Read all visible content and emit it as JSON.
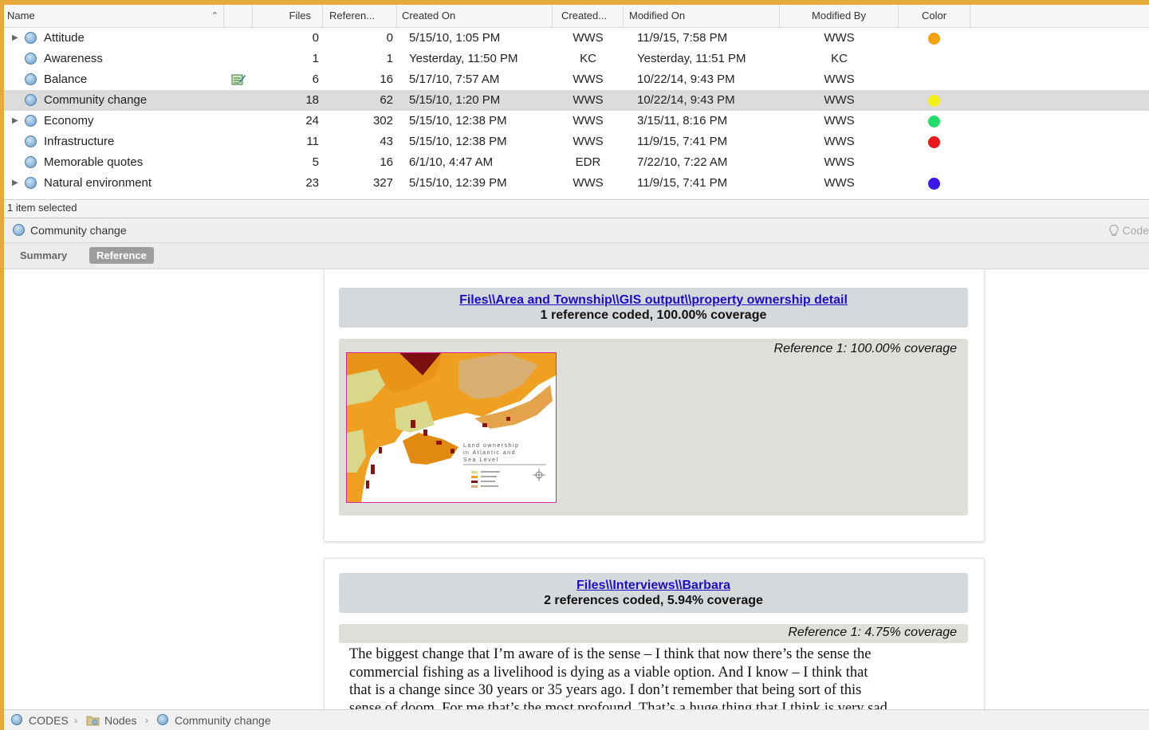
{
  "columns": {
    "name": "Name",
    "files": "Files",
    "references": "Referen...",
    "created_on": "Created On",
    "created_by": "Created...",
    "modified_on": "Modified On",
    "modified_by": "Modified By",
    "color": "Color"
  },
  "nodes": [
    {
      "name": "Attitude",
      "files": "0",
      "refs": "0",
      "created_on": "5/15/10, 1:05 PM",
      "created_by": "WWS",
      "modified_on": "11/9/15, 7:58 PM",
      "modified_by": "WWS",
      "color": "#f5a00f",
      "expandable": true,
      "memo": false,
      "selected": false
    },
    {
      "name": "Awareness",
      "files": "1",
      "refs": "1",
      "created_on": "Yesterday, 11:50 PM",
      "created_by": "KC",
      "modified_on": "Yesterday, 11:51 PM",
      "modified_by": "KC",
      "color": "",
      "expandable": false,
      "memo": false,
      "selected": false
    },
    {
      "name": "Balance",
      "files": "6",
      "refs": "16",
      "created_on": "5/17/10, 7:57 AM",
      "created_by": "WWS",
      "modified_on": "10/22/14, 9:43 PM",
      "modified_by": "WWS",
      "color": "",
      "expandable": false,
      "memo": true,
      "selected": false
    },
    {
      "name": "Community change",
      "files": "18",
      "refs": "62",
      "created_on": "5/15/10, 1:20 PM",
      "created_by": "WWS",
      "modified_on": "10/22/14, 9:43 PM",
      "modified_by": "WWS",
      "color": "#f5ee18",
      "expandable": false,
      "memo": false,
      "selected": true
    },
    {
      "name": "Economy",
      "files": "24",
      "refs": "302",
      "created_on": "5/15/10, 12:38 PM",
      "created_by": "WWS",
      "modified_on": "3/15/11, 8:16 PM",
      "modified_by": "WWS",
      "color": "#22dd6a",
      "expandable": true,
      "memo": false,
      "selected": false
    },
    {
      "name": "Infrastructure",
      "files": "11",
      "refs": "43",
      "created_on": "5/15/10, 12:38 PM",
      "created_by": "WWS",
      "modified_on": "11/9/15, 7:41 PM",
      "modified_by": "WWS",
      "color": "#e81818",
      "expandable": false,
      "memo": false,
      "selected": false
    },
    {
      "name": "Memorable quotes",
      "files": "5",
      "refs": "16",
      "created_on": "6/1/10, 4:47 AM",
      "created_by": "EDR",
      "modified_on": "7/22/10, 7:22 AM",
      "modified_by": "WWS",
      "color": "",
      "expandable": false,
      "memo": false,
      "selected": false
    },
    {
      "name": "Natural environment",
      "files": "23",
      "refs": "327",
      "created_on": "5/15/10, 12:39 PM",
      "created_by": "WWS",
      "modified_on": "11/9/15, 7:41 PM",
      "modified_by": "WWS",
      "color": "#3b18e8",
      "expandable": true,
      "memo": false,
      "selected": false
    }
  ],
  "status": "1 item selected",
  "detail": {
    "node_name": "Community change",
    "code_button": "Code",
    "tabs": {
      "summary": "Summary",
      "reference": "Reference"
    }
  },
  "references": [
    {
      "source_link": "Files\\\\Area and Township\\\\GIS output\\\\property ownership detail",
      "coverage": "1 reference coded, 100.00% coverage",
      "ref_caption": "Reference 1: 100.00% coverage",
      "map_title_lines": [
        "Land ownership",
        "in Atlantic and",
        "Sea Level"
      ]
    },
    {
      "source_link": "Files\\\\Interviews\\\\Barbara",
      "coverage": "2 references coded, 5.94% coverage",
      "ref_caption": "Reference 1: 4.75% coverage",
      "quote_lines": [
        "The biggest change that I’m aware of is the sense – I think that now there’s the sense the",
        "commercial fishing as a livelihood is dying as a viable option. And I know – I think that",
        "that is a change since 30 years or 35 years ago. I don’t remember that being sort of this",
        "sense of doom. For me that’s the most profound. That’s a huge thing that I think is very sad"
      ]
    }
  ],
  "breadcrumb": {
    "root": "CODES",
    "folder": "Nodes",
    "node": "Community change"
  }
}
